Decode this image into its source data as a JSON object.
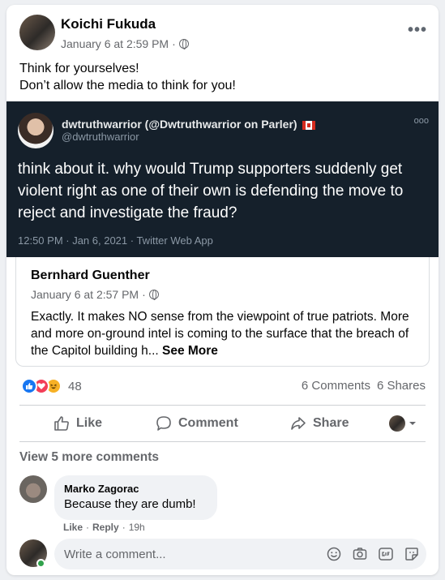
{
  "post": {
    "author": "Koichi Fukuda",
    "timestamp": "January 6 at 2:59 PM",
    "separator": "·",
    "privacy_icon": "globe-icon",
    "menu_icon": "more-options-icon",
    "menu_label": "•••",
    "text_line1": "Think for yourselves!",
    "text_line2": "Don’t allow the media to think for you!"
  },
  "tweet": {
    "display_name": "dwtruthwarrior (@Dwtruthwarrior on Parler)",
    "flag_icon": "canada-flag-icon",
    "handle": "@dwtruthwarrior",
    "menu_label": "ooo",
    "body": "think about it. why would Trump supporters suddenly get violent right as one of their own is defending the move to reject and investigate the fraud?",
    "time": "12:50 PM · Jan 6, 2021 · Twitter Web App",
    "background": "#15202b"
  },
  "shared_post": {
    "author": "Bernhard Guenther",
    "timestamp": "January 6 at 2:57 PM",
    "separator": "·",
    "privacy_icon": "globe-icon",
    "text": "Exactly. It makes NO sense from the viewpoint of true patriots. More and more on-ground intel is coming to the surface that the breach of the Capitol building h... ",
    "see_more": "See More"
  },
  "stats": {
    "reaction_icons": [
      "like-reaction-icon",
      "love-reaction-icon",
      "haha-reaction-icon"
    ],
    "reaction_count": "48",
    "comments": "6 Comments",
    "shares": "6 Shares"
  },
  "actions": {
    "like": "Like",
    "comment": "Comment",
    "share": "Share"
  },
  "comments": {
    "view_more": "View 5 more comments",
    "items": [
      {
        "author": "Marko Zagorac",
        "text": "Because they are dumb!",
        "like": "Like",
        "reply": "Reply",
        "separator": "·",
        "age": "19h"
      }
    ]
  },
  "composer": {
    "placeholder": "Write a comment...",
    "icons": [
      "emoji-icon",
      "camera-icon",
      "gif-icon",
      "sticker-icon"
    ]
  },
  "colors": {
    "accent": "#1877f2",
    "love": "#f33e58",
    "haha": "#f7b125",
    "online": "#31a24c"
  }
}
